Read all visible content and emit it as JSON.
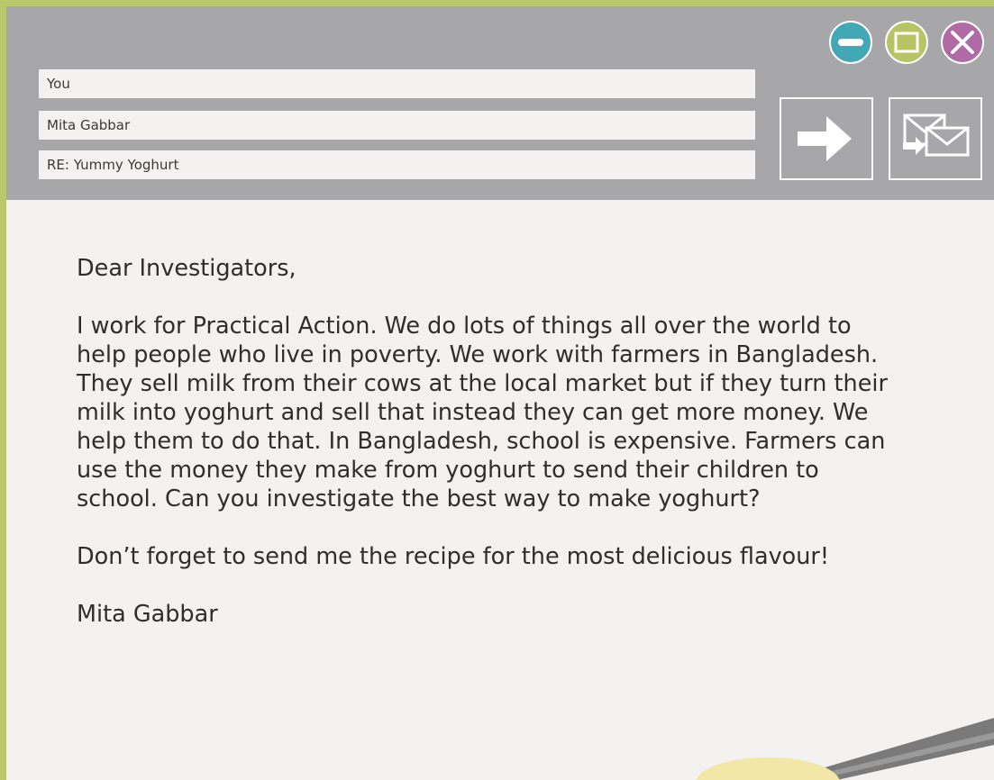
{
  "email": {
    "to": "You",
    "from": "Mita Gabbar",
    "subject": "RE: Yummy Yoghurt",
    "greeting": "Dear Investigators,",
    "paragraph": "I work for Practical Action. We do lots of things all over the world to help people who live in poverty. We work with farmers in Bangladesh. They sell milk from their cows at the local market but if they turn their milk into yoghurt and sell that instead they can get more money. We help them to do that. In Bangladesh, school is expensive. Farmers can use the money they make from yoghurt to send their children to school. Can you investigate the best way to make yoghurt?",
    "postscript": "Don’t forget to send me the recipe for the most delicious flavour!",
    "signature": "Mita Gabbar"
  },
  "icons": {
    "minimize": "minus-icon",
    "maximize": "square-icon",
    "close": "close-icon",
    "forward": "arrow-right-icon",
    "reply": "envelopes-icon"
  },
  "colors": {
    "page_border": "#b9c96b",
    "header": "#a7a6a8",
    "paper": "#f3f2f0",
    "minimize": "#43a8b6",
    "maximize": "#b7c463",
    "close": "#b06aa6",
    "spoon_bowl": "#f3e7a7",
    "spoon_handle": "#7a7a7a"
  }
}
